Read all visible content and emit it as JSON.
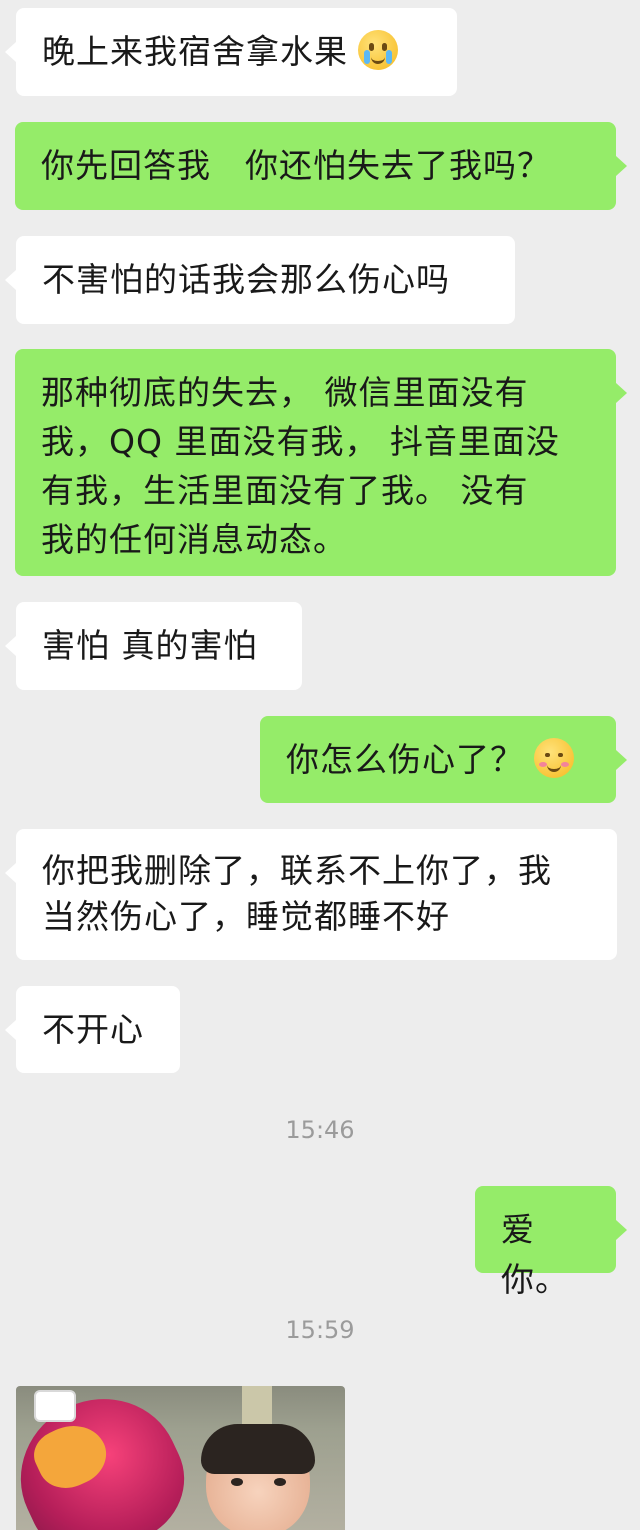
{
  "messages": [
    {
      "side": "left",
      "text": "晚上来我宿舍拿水果",
      "emoji": "crying-face-icon"
    },
    {
      "side": "right",
      "text": "你先回答我　你还怕失去了我吗？"
    },
    {
      "side": "left",
      "text": "不害怕的话我会那么伤心吗"
    },
    {
      "side": "right",
      "lines": [
        "那种彻底的失去， 微信里面没有",
        "我，QQ 里面没有我， 抖音里面没",
        "有我，生活里面没有了我。 没有",
        "我的任何消息动态。"
      ]
    },
    {
      "side": "left",
      "text": "害怕 真的害怕"
    },
    {
      "side": "right",
      "text": "你怎么伤心了？",
      "emoji": "blushing-smile-icon"
    },
    {
      "side": "left",
      "lines": [
        "你把我删除了，联系不上你了，我",
        "当然伤心了，睡觉都睡不好"
      ]
    },
    {
      "side": "left",
      "text": "不开心"
    },
    {
      "side": "right",
      "text": "爱你。"
    }
  ],
  "timestamps": [
    "15:46",
    "15:59"
  ],
  "image_message": {
    "side": "left",
    "description_icon": "baby-sticker-image"
  },
  "colors": {
    "background": "#ededed",
    "left_bubble": "#ffffff",
    "right_bubble": "#95ec69",
    "text": "#191919",
    "timestamp": "#9b9b9b"
  }
}
